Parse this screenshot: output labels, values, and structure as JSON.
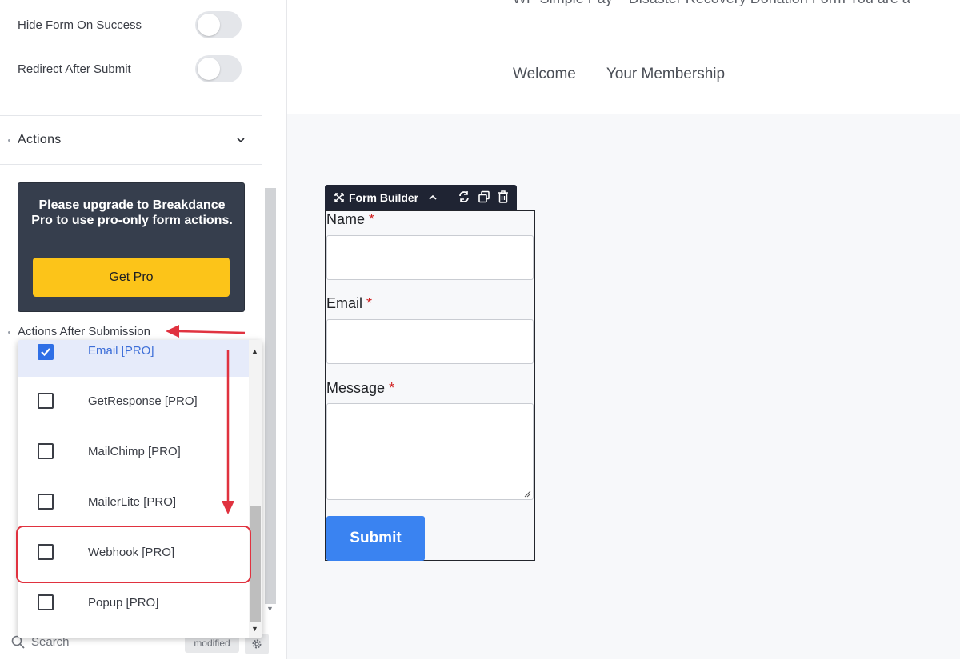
{
  "left_panel": {
    "hide_form_on_success": {
      "label": "Hide Form On Success",
      "on": false
    },
    "redirect_after_submit": {
      "label": "Redirect After Submit",
      "on": false
    },
    "actions_section_title": "Actions",
    "upgrade_notice": "Please upgrade to Breakdance Pro to use pro-only form actions.",
    "get_pro_label": "Get Pro",
    "actions_after_submission_label": "Actions After Submission",
    "dropdown_options": [
      {
        "label": "Email [PRO]",
        "checked": true
      },
      {
        "label": "GetResponse [PRO]",
        "checked": false
      },
      {
        "label": "MailChimp [PRO]",
        "checked": false
      },
      {
        "label": "MailerLite [PRO]",
        "checked": false
      },
      {
        "label": "Webhook [PRO]",
        "checked": false
      },
      {
        "label": "Popup [PRO]",
        "checked": false
      }
    ],
    "search_placeholder": "Search",
    "modified_badge": "modified"
  },
  "canvas": {
    "top_partial_text": "WP Simple Pay – Disaster Recovery Donation Form      You are a",
    "nav": [
      "Welcome",
      "Your Membership"
    ],
    "form_builder_title": "Form Builder",
    "fields": [
      {
        "label": "Name",
        "required_mark": "*"
      },
      {
        "label": "Email",
        "required_mark": "*"
      },
      {
        "label": "Message",
        "required_mark": "*"
      }
    ],
    "submit_label": "Submit"
  },
  "colors": {
    "accent_blue": "#3a83f1",
    "get_pro_yellow": "#fcc419",
    "highlight_red": "#e0323f",
    "upgrade_bg": "#363e4d"
  }
}
